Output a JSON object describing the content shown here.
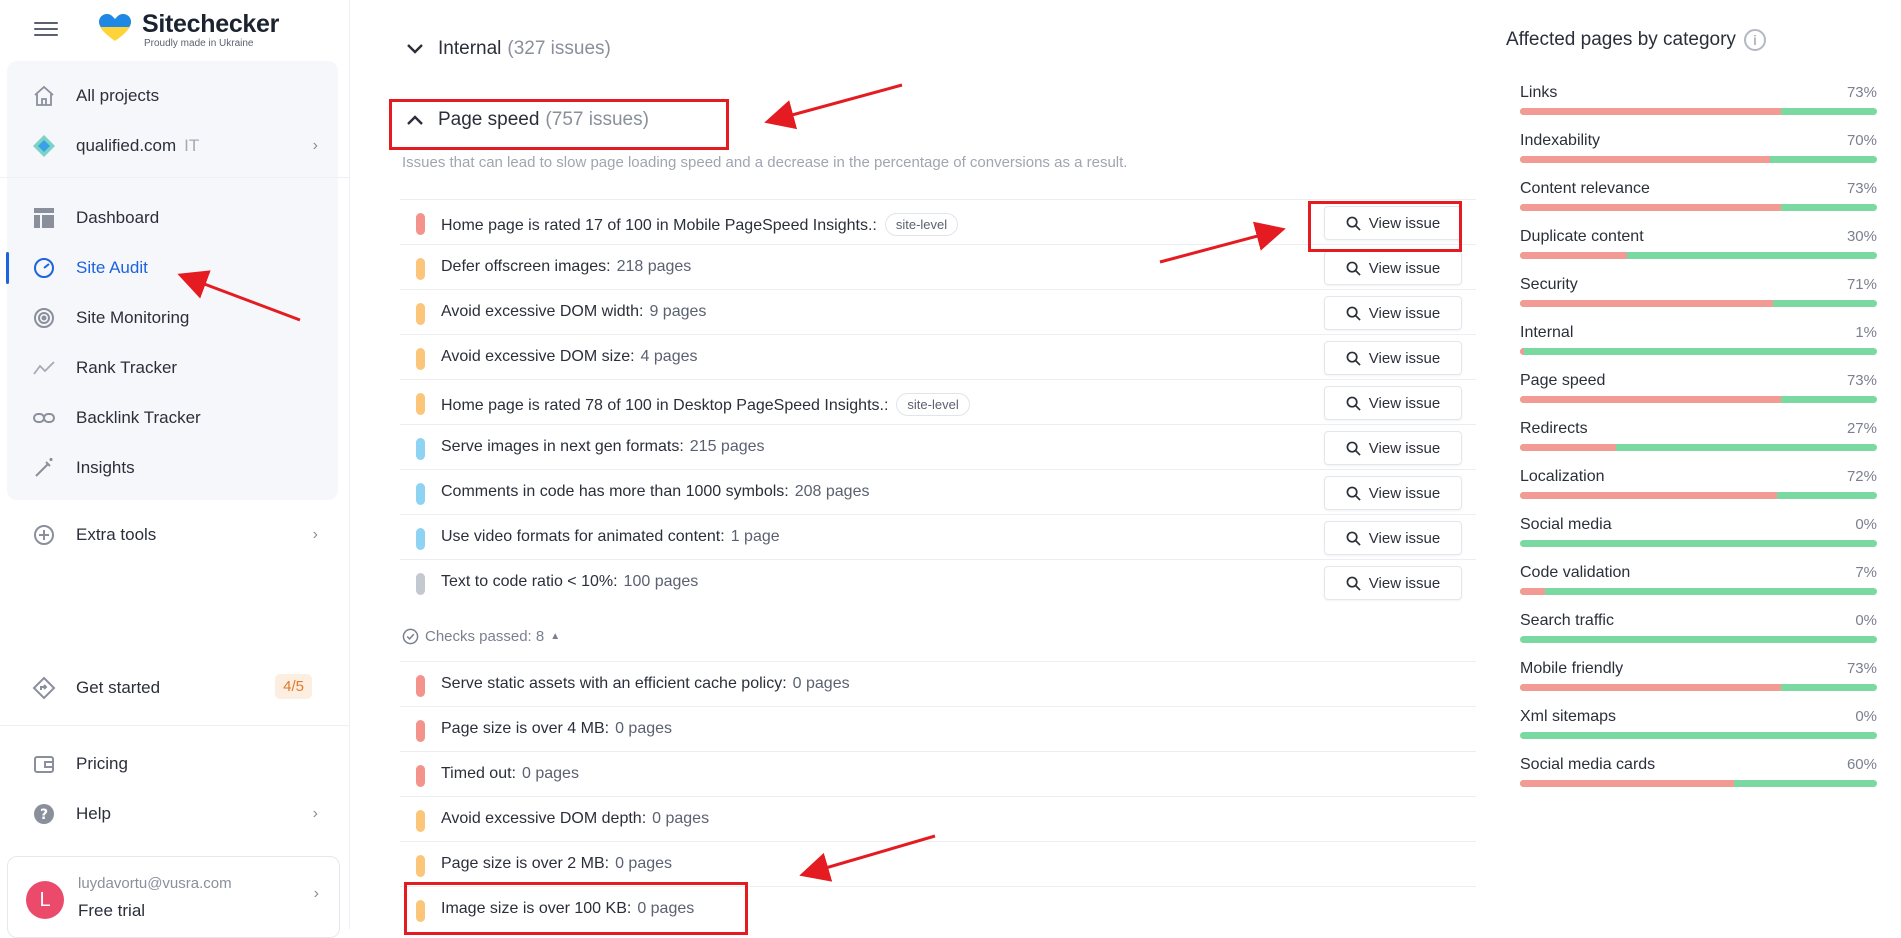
{
  "brand": {
    "name": "Sitechecker",
    "tagline": "Proudly made in Ukraine"
  },
  "sidebar": {
    "items": [
      {
        "label": "All projects",
        "icon": "home-icon"
      },
      {
        "label": "qualified.com",
        "suffix": "IT",
        "icon": "project-diamond-icon"
      },
      {
        "label": "Dashboard",
        "icon": "dashboard-icon"
      },
      {
        "label": "Site Audit",
        "icon": "speedometer-icon"
      },
      {
        "label": "Site Monitoring",
        "icon": "monitoring-icon"
      },
      {
        "label": "Rank Tracker",
        "icon": "rank-tracker-icon"
      },
      {
        "label": "Backlink Tracker",
        "icon": "link-icon"
      },
      {
        "label": "Insights",
        "icon": "magic-wand-icon"
      },
      {
        "label": "Extra tools",
        "icon": "plus-circle-icon"
      },
      {
        "label": "Get started",
        "icon": "directions-icon",
        "badge": "4/5"
      },
      {
        "label": "Pricing",
        "icon": "wallet-icon"
      },
      {
        "label": "Help",
        "icon": "help-icon"
      }
    ],
    "active": "Site Audit",
    "user": {
      "initial": "L",
      "email": "luydavortu@vusra.com",
      "plan": "Free trial"
    }
  },
  "main": {
    "internal": {
      "title": "Internal",
      "count": "(327 issues)"
    },
    "page_speed": {
      "title": "Page speed",
      "count": "(757 issues)",
      "description": "Issues that can lead to slow page loading speed and a decrease in the percentage of conversions as a result.",
      "view_label": "View issue",
      "site_level_label": "site-level",
      "issues": [
        {
          "text": "Home page is rated 17 of 100 in Mobile PageSpeed Insights.:",
          "pages": "",
          "site_level": true,
          "severity": "critical"
        },
        {
          "text": "Defer offscreen images:",
          "pages": "218 pages",
          "severity": "warning"
        },
        {
          "text": "Avoid excessive DOM width:",
          "pages": "9 pages",
          "severity": "warning"
        },
        {
          "text": "Avoid excessive DOM size:",
          "pages": "4 pages",
          "severity": "warning"
        },
        {
          "text": "Home page is rated 78 of 100 in Desktop PageSpeed Insights.:",
          "pages": "",
          "site_level": true,
          "severity": "warning"
        },
        {
          "text": "Serve images in next gen formats:",
          "pages": "215 pages",
          "severity": "opportunity"
        },
        {
          "text": "Comments in code has more than 1000 symbols:",
          "pages": "208 pages",
          "severity": "opportunity"
        },
        {
          "text": "Use video formats for animated content:",
          "pages": "1 page",
          "severity": "opportunity"
        },
        {
          "text": "Text to code ratio < 10%:",
          "pages": "100 pages",
          "severity": "notice"
        }
      ],
      "checks_passed_label": "Checks passed: 8",
      "passed": [
        {
          "text": "Serve static assets with an efficient cache policy:",
          "pages": "0 pages",
          "severity": "critical"
        },
        {
          "text": "Page size is over 4 MB:",
          "pages": "0 pages",
          "severity": "critical"
        },
        {
          "text": "Timed out:",
          "pages": "0 pages",
          "severity": "critical"
        },
        {
          "text": "Avoid excessive DOM depth:",
          "pages": "0 pages",
          "severity": "warning"
        },
        {
          "text": "Page size is over 2 MB:",
          "pages": "0 pages",
          "severity": "warning"
        },
        {
          "text": "Image size is over 100 KB:",
          "pages": "0 pages",
          "severity": "warning"
        }
      ]
    }
  },
  "severity_colors": {
    "critical": "#f4928c",
    "warning": "#fbc57a",
    "opportunity": "#8fd3f3",
    "notice": "#c3c8d1"
  },
  "right_panel": {
    "title": "Affected pages by category",
    "categories": [
      {
        "name": "Links",
        "percent": "73%",
        "value": 73
      },
      {
        "name": "Indexability",
        "percent": "70%",
        "value": 70
      },
      {
        "name": "Content relevance",
        "percent": "73%",
        "value": 73
      },
      {
        "name": "Duplicate content",
        "percent": "30%",
        "value": 30
      },
      {
        "name": "Security",
        "percent": "71%",
        "value": 71
      },
      {
        "name": "Internal",
        "percent": "1%",
        "value": 1
      },
      {
        "name": "Page speed",
        "percent": "73%",
        "value": 73
      },
      {
        "name": "Redirects",
        "percent": "27%",
        "value": 27
      },
      {
        "name": "Localization",
        "percent": "72%",
        "value": 72
      },
      {
        "name": "Social media",
        "percent": "0%",
        "value": 0
      },
      {
        "name": "Code validation",
        "percent": "7%",
        "value": 7
      },
      {
        "name": "Search traffic",
        "percent": "0%",
        "value": 0
      },
      {
        "name": "Mobile friendly",
        "percent": "73%",
        "value": 73
      },
      {
        "name": "Xml sitemaps",
        "percent": "0%",
        "value": 0
      },
      {
        "name": "Social media cards",
        "percent": "60%",
        "value": 60
      }
    ]
  }
}
